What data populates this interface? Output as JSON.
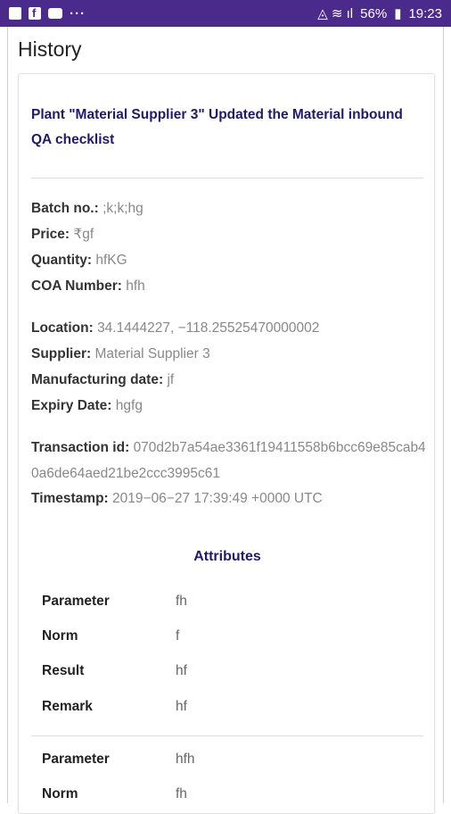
{
  "status_bar": {
    "battery": "56%",
    "time": "19:23"
  },
  "page": {
    "title": "History"
  },
  "card": {
    "heading": "Plant \"Material Supplier 3\" Updated the Material inbound QA checklist",
    "fields_group1": [
      {
        "label": "Batch no.:",
        "value": ";k;k;hg"
      },
      {
        "label": "Price:",
        "value": "₹gf"
      },
      {
        "label": "Quantity:",
        "value": "hfKG"
      },
      {
        "label": "COA Number:",
        "value": "hfh"
      }
    ],
    "fields_group2": [
      {
        "label": "Location:",
        "value": "34.1444227, −118.25525470000002"
      },
      {
        "label": "Supplier:",
        "value": "Material Supplier 3"
      },
      {
        "label": "Manufacturing date:",
        "value": "jf"
      },
      {
        "label": "Expiry Date:",
        "value": "hgfg"
      }
    ],
    "transaction": {
      "label": "Transaction id:",
      "value": "070d2b7a54ae3361f19411558b6bcc69e85cab40a6de64aed21be2ccc3995c61"
    },
    "timestamp": {
      "label": "Timestamp:",
      "value": "2019−06−27 17:39:49 +0000 UTC"
    },
    "attributes_title": "Attributes",
    "attributes": [
      {
        "label": "Parameter",
        "value": "fh"
      },
      {
        "label": "Norm",
        "value": "f"
      },
      {
        "label": "Result",
        "value": "hf"
      },
      {
        "label": "Remark",
        "value": "hf"
      },
      {
        "label": "Parameter",
        "value": "hfh"
      },
      {
        "label": "Norm",
        "value": "fh"
      }
    ]
  }
}
